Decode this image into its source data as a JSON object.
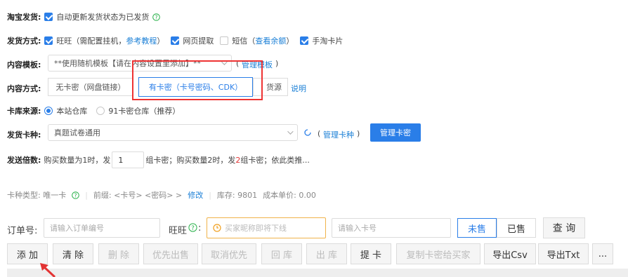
{
  "taobao": {
    "label": "淘宝发货:",
    "auto_update": "自动更新发货状态为已发货"
  },
  "ship_method": {
    "label": "发货方式:",
    "wangwang": "旺旺（需配置挂机，",
    "ref_tutorial": "参考教程",
    "wangwang_close": "）",
    "web_fetch": "网页提取",
    "sms": "短信（",
    "check_balance": "查看余额",
    "sms_close": "）",
    "handtao_card": "手淘卡片"
  },
  "content_template": {
    "label": "内容模板:",
    "value": "**使用随机模板【请在内容设置里添加】**",
    "manage_template": "管理模板"
  },
  "content_method": {
    "label": "内容方式:",
    "options": [
      "无卡密（网盘链接）",
      "有卡密（卡号密码、CDK）",
      "货源"
    ],
    "explain": "说明"
  },
  "card_source": {
    "label": "卡库来源:",
    "local": "本站仓库",
    "ninety_one": "91卡密仓库（推荐）"
  },
  "card_type": {
    "label": "发货卡种:",
    "value": "真题试卷通用",
    "manage_type": "管理卡种",
    "manage_card_btn": "管理卡密"
  },
  "send_multiple": {
    "label": "发送倍数:",
    "text_before": "购买数量为1时，发",
    "value": "1",
    "text_mid": "组卡密；购买数量2时，发",
    "highlight": "2",
    "text_after": "组卡密；依此类推..."
  },
  "info_bar": {
    "kind": "卡种类型: 唯一卡",
    "prefix": "前缀: <卡号>  <密码>  >",
    "modify": "修改",
    "stock": "库存: 9801",
    "cost": "成本单价: 0.00"
  },
  "search": {
    "order_label": "订单号:",
    "order_placeholder": "请输入订单编号",
    "ww_label": "旺旺",
    "ww_placeholder": "买家昵称即将下线",
    "card_placeholder": "请输入卡号",
    "unsold": "未售",
    "sold": "已售",
    "query": "查 询"
  },
  "toolbar": [
    "添 加",
    "清 除",
    "删 除",
    "优先出售",
    "取消优先",
    "回 库",
    "出 库",
    "提 卡",
    "复制卡密给买家",
    "导出Csv",
    "导出Txt",
    "..."
  ],
  "colors": {
    "accent": "#2a7ee8",
    "highlight": "#e33333"
  }
}
